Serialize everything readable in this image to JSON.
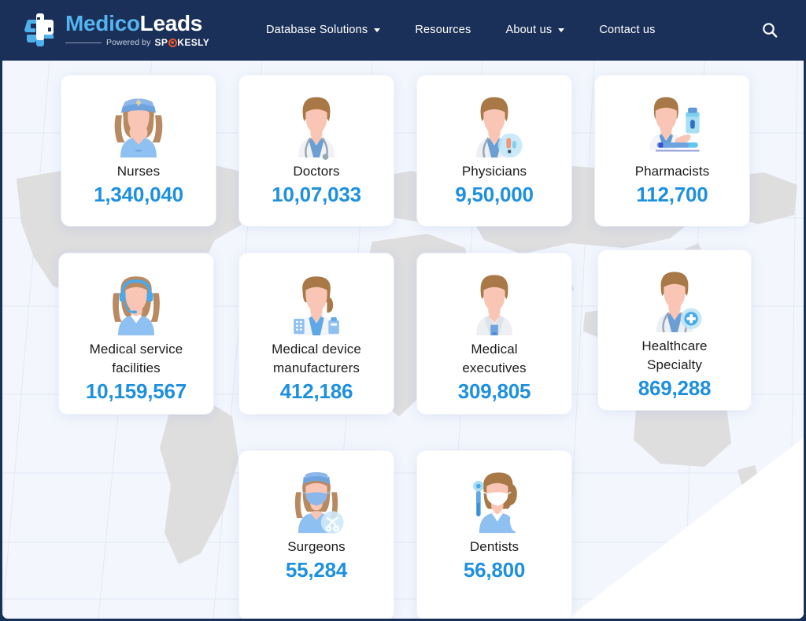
{
  "header": {
    "logo": {
      "name_primary": "Medico",
      "name_secondary": "Leads",
      "powered_by": "Powered by",
      "brand_pre": "SP",
      "brand_post": "KESLY",
      "mark_icon": "medical-cross-icon",
      "accent_color": "#55b3ef",
      "brand_accent_color": "#e8552a"
    },
    "background_color": "#1a3059",
    "nav": [
      {
        "label": "Database Solutions",
        "has_dropdown": true
      },
      {
        "label": "Resources",
        "has_dropdown": false
      },
      {
        "label": "About us",
        "has_dropdown": true
      },
      {
        "label": "Contact us",
        "has_dropdown": false
      }
    ],
    "search": {
      "icon": "search-icon"
    }
  },
  "page": {
    "background_color": "#f3f6fd",
    "map_color": "#dededf",
    "value_color": "#1e90e0",
    "label_color": "#1b1b1b"
  },
  "stats": {
    "rows": [
      [
        {
          "label": "Nurses",
          "value": "1,340,040",
          "icon": "nurse-avatar-icon"
        },
        {
          "label": "Doctors",
          "value": "10,07,033",
          "icon": "doctor-avatar-icon"
        },
        {
          "label": "Physicians",
          "value": "9,50,000",
          "icon": "physician-avatar-icon"
        },
        {
          "label": "Pharmacists",
          "value": "112,700",
          "icon": "pharmacist-avatar-icon"
        }
      ],
      [
        {
          "label": "Medical service\nfacilities",
          "value": "10,159,567",
          "icon": "medical-service-agent-icon"
        },
        {
          "label": "Medical device\nmanufacturers",
          "value": "412,186",
          "icon": "medical-device-maker-icon"
        },
        {
          "label": "Medical\nexecutives",
          "value": "309,805",
          "icon": "medical-executive-icon"
        },
        {
          "label": "Healthcare\nSpecialty",
          "value": "869,288",
          "icon": "healthcare-specialty-icon"
        }
      ],
      [
        {
          "label": "Surgeons",
          "value": "55,284",
          "icon": "surgeon-avatar-icon"
        },
        {
          "label": "Dentists",
          "value": "56,800",
          "icon": "dentist-avatar-icon"
        }
      ]
    ]
  }
}
